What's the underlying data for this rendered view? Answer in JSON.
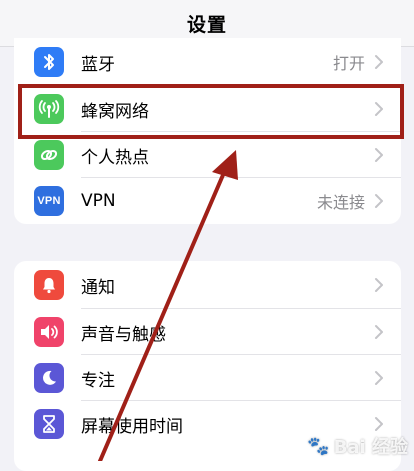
{
  "header": {
    "title": "设置"
  },
  "group1": {
    "items": [
      {
        "label": "蓝牙",
        "value": "打开",
        "icon": "bluetooth-icon",
        "color": "#2f7cf6"
      },
      {
        "label": "蜂窝网络",
        "value": "",
        "icon": "cellular-antenna-icon",
        "color": "#4cc95c"
      },
      {
        "label": "个人热点",
        "value": "",
        "icon": "hotspot-chain-icon",
        "color": "#4cc95c"
      },
      {
        "label": "VPN",
        "value": "未连接",
        "icon": "vpn-icon",
        "icon_text": "VPN",
        "color": "#2f6fdf"
      }
    ]
  },
  "group2": {
    "items": [
      {
        "label": "通知",
        "icon": "notification-bell-icon",
        "color": "#ef4a3d"
      },
      {
        "label": "声音与触感",
        "icon": "speaker-icon",
        "color": "#f0436a"
      },
      {
        "label": "专注",
        "icon": "moon-icon",
        "color": "#5b57d6"
      },
      {
        "label": "屏幕使用时间",
        "icon": "hourglass-icon",
        "color": "#5b57d6"
      }
    ]
  },
  "annotation": {
    "highlight_color": "#a02018"
  },
  "watermark": {
    "text": "Bai 经验"
  }
}
